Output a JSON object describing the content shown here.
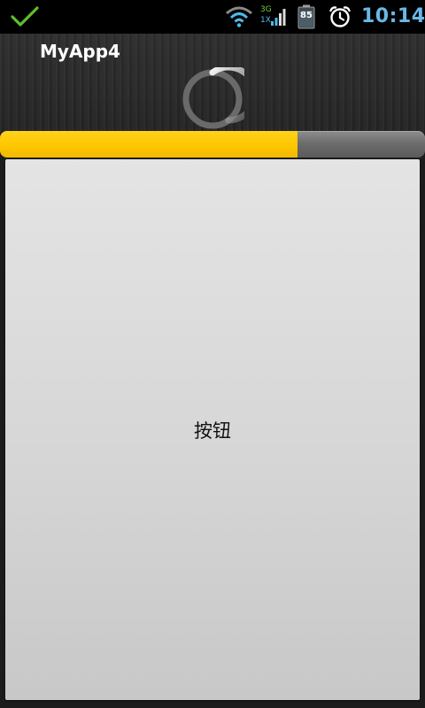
{
  "status_bar": {
    "time": "10:14",
    "battery_level": "85",
    "network_type_top": "3G",
    "network_type_bottom": "1X",
    "icons": [
      "checkmark-icon",
      "wifi-icon",
      "signal-icon",
      "battery-icon",
      "alarm-clock-icon"
    ]
  },
  "app": {
    "title": "MyApp4"
  },
  "progress": {
    "value_fraction": 0.7
  },
  "main": {
    "button_label": "按钮"
  },
  "colors": {
    "progress_fill": "#ffc700",
    "clock_text": "#69b8e6",
    "check": "#5fbf2a"
  }
}
